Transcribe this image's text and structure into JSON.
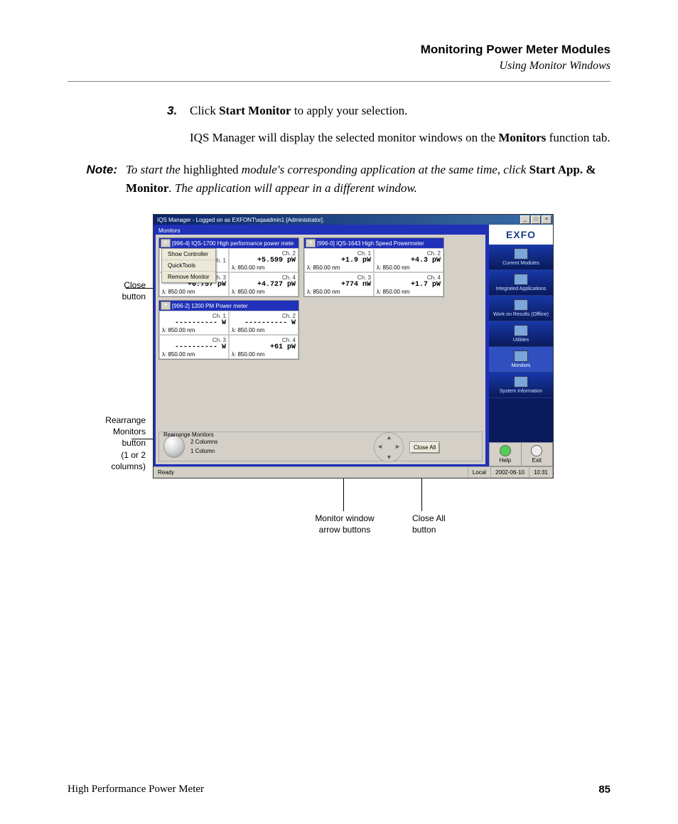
{
  "header": {
    "title": "Monitoring Power Meter Modules",
    "subtitle": "Using Monitor Windows"
  },
  "step": {
    "number": "3.",
    "line1_pre": "Click ",
    "line1_bold": "Start Monitor",
    "line1_post": " to apply your selection.",
    "line2_pre": "IQS Manager will display the selected monitor windows on the ",
    "line2_bold": "Monitors",
    "line2_post": " function tab."
  },
  "note": {
    "label": "Note:",
    "seg1": "To start the ",
    "seg2_roman": "highlighted",
    "seg3": " module's corresponding application at the same time, click ",
    "seg4_bold": "Start App. & Monitor",
    "seg5": ". The application will appear in a different window."
  },
  "callouts": {
    "close": "Close\nbutton",
    "rearrange": "Rearrange\nMonitors\nbutton\n(1 or 2\ncolumns)",
    "arrows": "Monitor window\narrow buttons",
    "closeall": "Close All\nbutton"
  },
  "app": {
    "titlebar": "IQS Manager - Logged on as EXFONT\\sqaadmin1 [Administrator].",
    "tab": "Monitors",
    "context_menu": [
      "Show Controller",
      "QuickTools",
      "Remove Monitor"
    ],
    "monitors": [
      {
        "title": "[996-4] IQS-1700 High performance power mete",
        "channels": [
          {
            "label": "Ch. 1",
            "val": "",
            "lambda": ""
          },
          {
            "label": "Ch. 2",
            "val": "+5.599 pW",
            "lambda": "λ: 850.00 nm"
          },
          {
            "label": "Ch. 3",
            "val": "+6.757 pW",
            "lambda": "λ: 850.00 nm"
          },
          {
            "label": "Ch. 4",
            "val": "+4.727 pW",
            "lambda": "λ: 850.00 nm"
          }
        ]
      },
      {
        "title": "[996-0] IQS-1643 High Speed Powermeter",
        "channels": [
          {
            "label": "Ch. 1",
            "val": "+1.9 pW",
            "lambda": "λ: 850.00 nm"
          },
          {
            "label": "Ch. 2",
            "val": "+4.3 pW",
            "lambda": "λ: 850.00 nm"
          },
          {
            "label": "Ch. 3",
            "val": "+774 nW",
            "lambda": "λ: 850.00 nm"
          },
          {
            "label": "Ch. 4",
            "val": "+1.7 pW",
            "lambda": "λ: 850.00 nm"
          }
        ]
      },
      {
        "title": "[996-2] 1200 PM Power meter",
        "channels": [
          {
            "label": "Ch. 1",
            "val": "---------- W",
            "lambda": "λ: 850.00 nm"
          },
          {
            "label": "Ch. 2",
            "val": "---------- W",
            "lambda": "λ: 850.00 nm"
          },
          {
            "label": "Ch. 3",
            "val": "---------- W",
            "lambda": "λ: 850.00 nm"
          },
          {
            "label": "Ch. 4",
            "val": "+61 pW",
            "lambda": "λ: 850.00 nm"
          }
        ]
      }
    ],
    "rearrange": {
      "title": "Rearrange Monitors",
      "opt1": "2 Columns",
      "opt2": "1 Column"
    },
    "close_all": "Close All",
    "status": {
      "ready": "Ready",
      "mode": "Local",
      "date": "2002-06-10",
      "time": "10:31"
    },
    "sidebar": {
      "logo": "EXFO",
      "items": [
        "Current Modules",
        "Integrated Applications",
        "Work on Results (Offline)",
        "Utilities",
        "Monitors",
        "System Information"
      ],
      "help": "Help",
      "exit": "Exit"
    }
  },
  "footer": {
    "left": "High Performance Power Meter",
    "page": "85"
  }
}
